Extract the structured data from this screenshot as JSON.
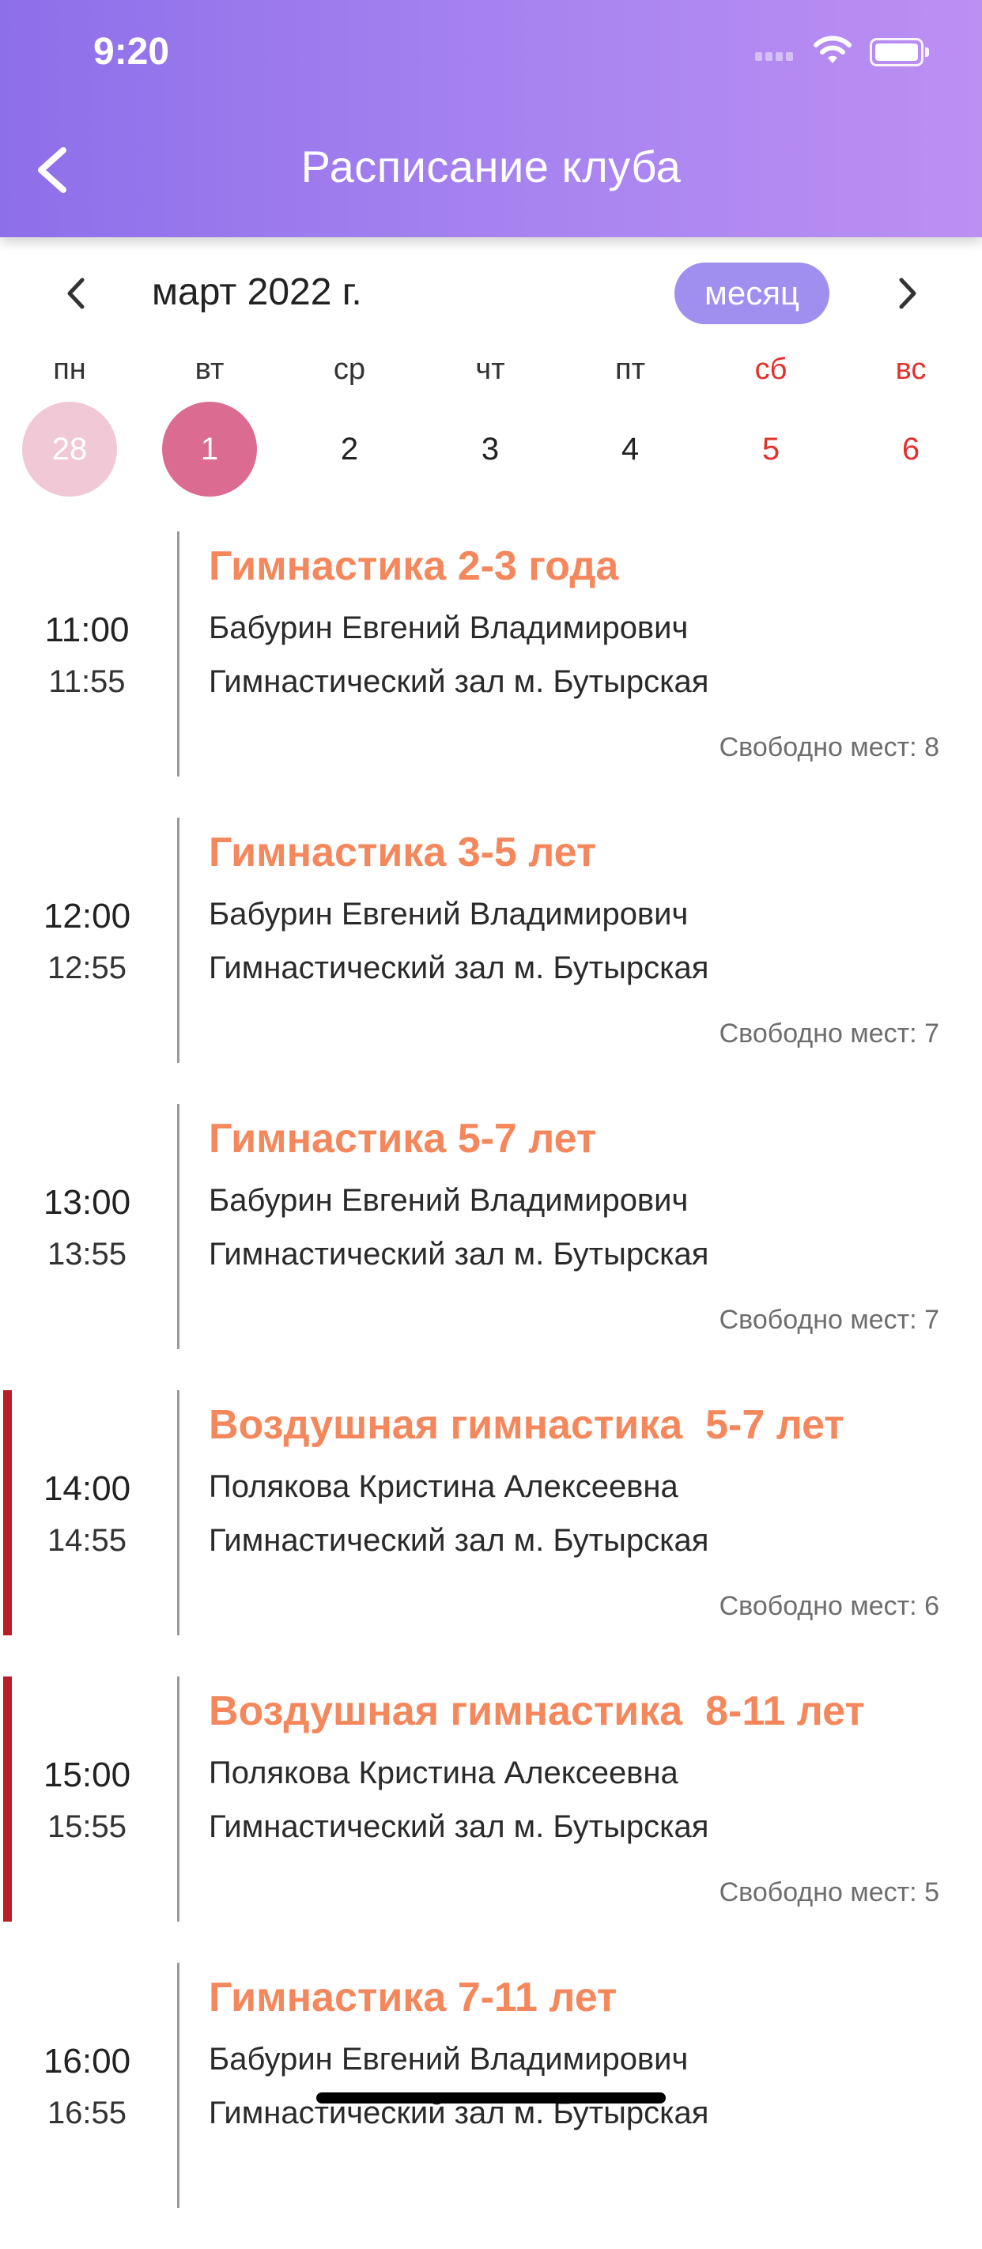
{
  "status_bar": {
    "time": "9:20"
  },
  "header": {
    "title": "Расписание клуба",
    "back_icon": "chevron-left-icon"
  },
  "calendar": {
    "month_label": "март 2022 г.",
    "view_toggle": "месяц",
    "weekdays": [
      "пн",
      "вт",
      "ср",
      "чт",
      "пт",
      "сб",
      "вс"
    ],
    "days": [
      "28",
      "1",
      "2",
      "3",
      "4",
      "5",
      "6"
    ],
    "weekend_color": "#e0322c",
    "selected_color": "#dc6b92"
  },
  "accent_color": "#f4875c",
  "schedule": [
    {
      "start": "11:00",
      "end": "11:55",
      "title": "Гимнастика 2-3 года",
      "trainer": "Бабурин Евгений Владимирович",
      "place": "Гимнастический зал м. Бутырская",
      "seats": "Свободно мест: 8",
      "highlight": false
    },
    {
      "start": "12:00",
      "end": "12:55",
      "title": "Гимнастика 3-5 лет",
      "trainer": "Бабурин Евгений Владимирович",
      "place": "Гимнастический зал м. Бутырская",
      "seats": "Свободно мест: 7",
      "highlight": false
    },
    {
      "start": "13:00",
      "end": "13:55",
      "title": "Гимнастика 5-7 лет",
      "trainer": "Бабурин Евгений Владимирович",
      "place": "Гимнастический зал м. Бутырская",
      "seats": "Свободно мест: 7",
      "highlight": false
    },
    {
      "start": "14:00",
      "end": "14:55",
      "title": "Воздушная гимнастика  5-7 лет",
      "trainer": "Полякова Кристина Алексеевна",
      "place": "Гимнастический зал м. Бутырская",
      "seats": "Свободно мест: 6",
      "highlight": true
    },
    {
      "start": "15:00",
      "end": "15:55",
      "title": "Воздушная гимнастика  8-11 лет",
      "trainer": "Полякова Кристина Алексеевна",
      "place": "Гимнастический зал м. Бутырская",
      "seats": "Свободно мест: 5",
      "highlight": true
    },
    {
      "start": "16:00",
      "end": "16:55",
      "title": "Гимнастика 7-11 лет",
      "trainer": "Бабурин Евгений Владимирович",
      "place": "Гимнастический зал м. Бутырская",
      "seats": "",
      "highlight": false
    }
  ]
}
